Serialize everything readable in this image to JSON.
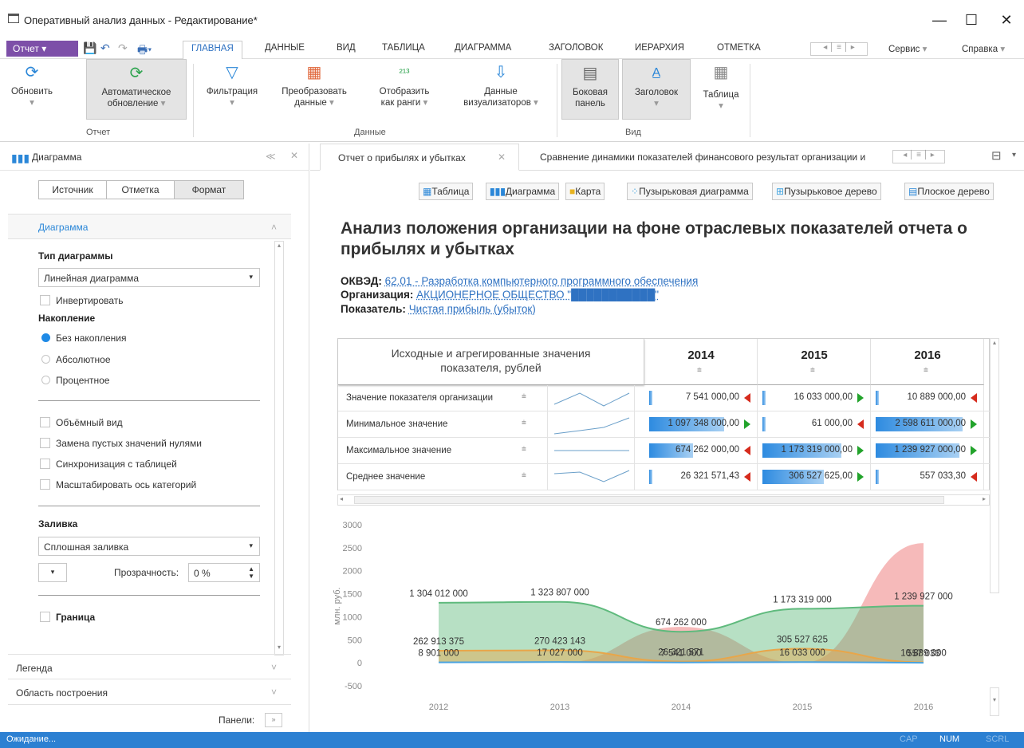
{
  "window": {
    "title": "Оперативный анализ данных - Редактирование*",
    "minimize": "—",
    "maximize": "☐",
    "close": "✕"
  },
  "menu": {
    "report_btn": "Отчет",
    "tabs": [
      "ГЛАВНАЯ",
      "ДАННЫЕ",
      "ВИД",
      "ТАБЛИЦА",
      "ДИАГРАММА",
      "ЗАГОЛОВОК",
      "ИЕРАРХИЯ",
      "ОТМЕТКА"
    ],
    "service": "Сервис",
    "help": "Справка"
  },
  "ribbon": {
    "refresh": "Обновить",
    "auto_refresh_1": "Автоматическое",
    "auto_refresh_2": "обновление",
    "filter": "Фильтрация",
    "transform_1": "Преобразовать",
    "transform_2": "данные",
    "ranks_1": "Отобразить",
    "ranks_2": "как ранги",
    "visdata_1": "Данные",
    "visdata_2": "визуализаторов",
    "sidepanel_1": "Боковая",
    "sidepanel_2": "панель",
    "header": "Заголовок",
    "table": "Таблица",
    "group_report": "Отчет",
    "group_data": "Данные",
    "group_view": "Вид"
  },
  "leftpanel": {
    "title": "Диаграмма",
    "tabs": [
      "Источник",
      "Отметка",
      "Формат"
    ],
    "section_chart": "Диаграмма",
    "chart_type_label": "Тип диаграммы",
    "chart_type_value": "Линейная диаграмма",
    "invert": "Инвертировать",
    "accum_label": "Накопление",
    "accum_options": [
      "Без накопления",
      "Абсолютное",
      "Процентное"
    ],
    "volume": "Объёмный вид",
    "replace_empty": "Замена пустых значений нулями",
    "sync_table": "Синхронизация с таблицей",
    "scale_axis": "Масштабировать ось категорий",
    "fill_label": "Заливка",
    "fill_value": "Сплошная заливка",
    "transparency_label": "Прозрачность:",
    "transparency_value": "0 %",
    "border_label": "Граница",
    "legend": "Легенда",
    "plot_area": "Область построения",
    "panels": "Панели:"
  },
  "tabs": {
    "tab1": "Отчет о прибылях и убытках",
    "tab2": "Сравнение динамики показателей финансового результат организации и"
  },
  "views": [
    "Таблица",
    "Диаграмма",
    "Карта",
    "Пузырьковая диаграмма",
    "Пузырьковое дерево",
    "Плоское дерево"
  ],
  "report": {
    "title": "Анализ положения организации на фоне отраслевых показателей отчета о прибылях и убытках",
    "okved_label": "ОКВЭД:",
    "okved_value": "62.01 - Разработка компьютерного программного обеспечения",
    "org_label": "Организация:",
    "org_value": "АКЦИОНЕРНОЕ ОБЩЕСТВО \"███████████\"",
    "ind_label": "Показатель:",
    "ind_value": "Чистая прибыль (убыток)"
  },
  "table": {
    "header": "Исходные и агрегированные значения показателя, рублей",
    "years": [
      "2014",
      "2015",
      "2016"
    ],
    "rows": [
      {
        "name": "Значение показателя организации",
        "v": [
          "7 541 000,00",
          "16 033 000,00",
          "10 889 000,00"
        ],
        "dir": [
          "dn",
          "up",
          "dn"
        ],
        "bar": [
          0.02,
          0.04,
          0.03
        ]
      },
      {
        "name": "Минимальное значение",
        "v": [
          "1 097 348 000,00",
          "61 000,00",
          "2 598 611 000,00"
        ],
        "dir": [
          "up",
          "dn",
          "up"
        ],
        "bar": [
          0.85,
          0.02,
          0.99
        ]
      },
      {
        "name": "Максимальное значение",
        "v": [
          "674 262 000,00",
          "1 173 319 000,00",
          "1 239 927 000,00"
        ],
        "dir": [
          "dn",
          "up",
          "up"
        ],
        "bar": [
          0.5,
          0.9,
          0.95
        ]
      },
      {
        "name": "Среднее значение",
        "v": [
          "26 321 571,43",
          "306 527 625,00",
          "557 033,30"
        ],
        "dir": [
          "dn",
          "up",
          "dn"
        ],
        "bar": [
          0.03,
          0.7,
          0.02
        ]
      }
    ]
  },
  "chart_data": {
    "type": "area",
    "x": [
      "2012",
      "2013",
      "2014",
      "2015",
      "2016"
    ],
    "ylabel": "млн. руб.",
    "yticks": [
      "3000",
      "2500",
      "2000",
      "1500",
      "1000",
      "500",
      "0",
      "-500"
    ],
    "ylim": [
      -500,
      3000
    ],
    "series": [
      {
        "values": [
          1304.012,
          1323.807,
          674.262,
          1173.319,
          1239.927
        ],
        "color": "#5fba7d"
      },
      {
        "values": [
          262.913375,
          270.423143,
          26.321571,
          305.527625,
          10.889
        ],
        "color": "#e8a64a"
      },
      {
        "values": [
          8.901,
          17.027,
          7.541,
          16.033,
          0.557033
        ],
        "color": "#4aa3df"
      },
      {
        "values": [
          0,
          0,
          780,
          0,
          2600
        ],
        "color": "#f08c8c"
      }
    ],
    "labels": [
      {
        "text": "1 304 012 000",
        "x": "2012",
        "y": 1304
      },
      {
        "text": "1 323 807 000",
        "x": "2013",
        "y": 1324
      },
      {
        "text": "674 262 000",
        "x": "2014",
        "y": 674
      },
      {
        "text": "1 173 319 000",
        "x": "2015",
        "y": 1173
      },
      {
        "text": "1 239 927 000",
        "x": "2016",
        "y": 1240
      },
      {
        "text": "262 913 375",
        "x": "2012",
        "y": 263
      },
      {
        "text": "270 423 143",
        "x": "2013",
        "y": 270
      },
      {
        "text": "26 321 571",
        "x": "2014",
        "y": 26
      },
      {
        "text": "305 527 625",
        "x": "2015",
        "y": 306
      },
      {
        "text": "10 889 000",
        "x": "2016",
        "y": 11
      },
      {
        "text": "8 901 000",
        "x": "2012",
        "y": 9
      },
      {
        "text": "17 027 000",
        "x": "2013",
        "y": 17
      },
      {
        "text": "7 541 000",
        "x": "2014",
        "y": 8
      },
      {
        "text": "16 033 000",
        "x": "2015",
        "y": 16
      },
      {
        "text": "557 033",
        "x": "2016",
        "y": 1
      }
    ]
  },
  "status": {
    "text": "Ожидание...",
    "cap": "CAP",
    "num": "NUM",
    "scrl": "SCRL"
  }
}
